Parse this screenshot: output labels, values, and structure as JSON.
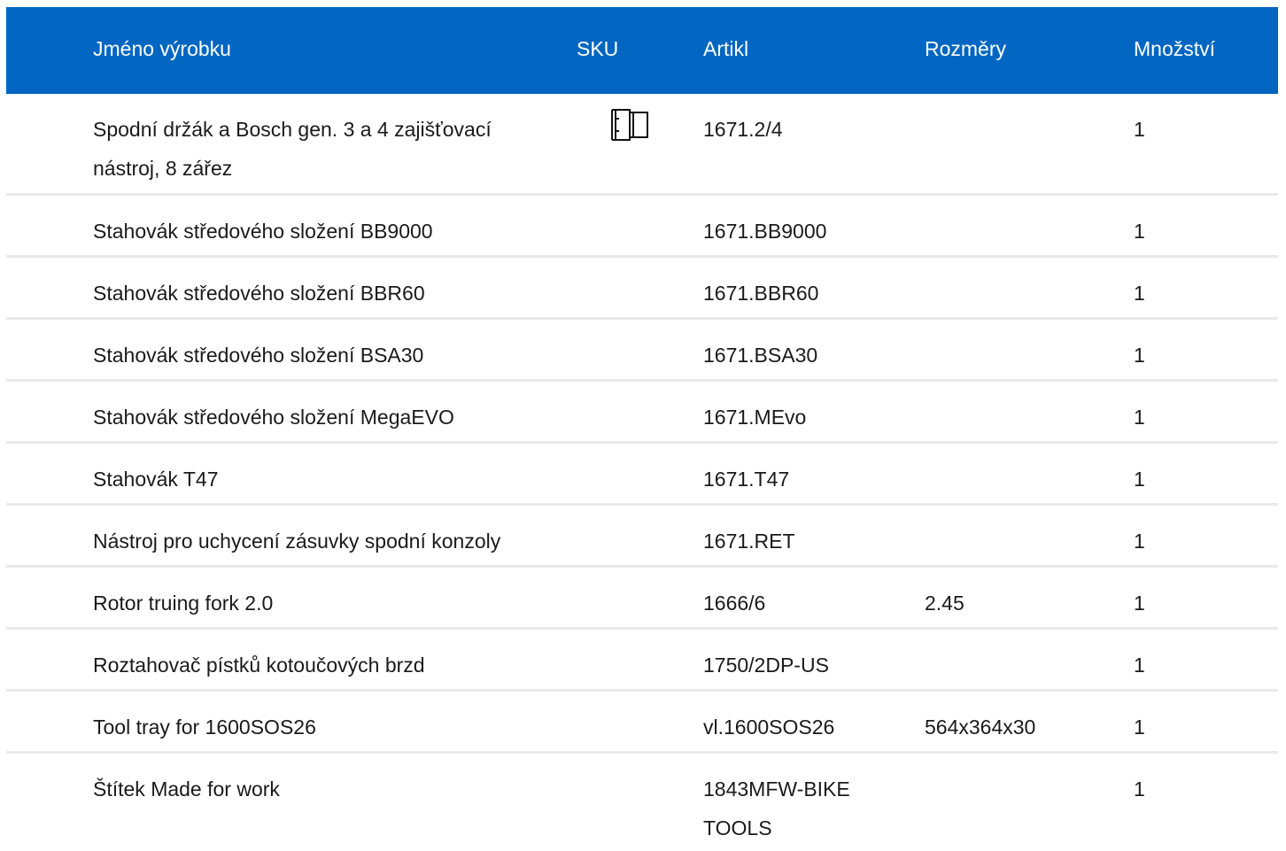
{
  "table": {
    "headers": {
      "name": "Jméno výrobku",
      "sku": "SKU",
      "article": "Artikl",
      "dimensions": "Rozměry",
      "quantity": "Množství"
    },
    "rows": [
      {
        "name": "Spodní držák a Bosch gen. 3 a 4 zajišťovací nástroj, 8 zářez",
        "sku_icon": "socket-tool-icon",
        "article": "1671.2/4",
        "dimensions": "",
        "quantity": "1"
      },
      {
        "name": "Stahovák středového složení BB9000",
        "article": "1671.BB9000",
        "dimensions": "",
        "quantity": "1"
      },
      {
        "name": "Stahovák středového složení BBR60",
        "article": "1671.BBR60",
        "dimensions": "",
        "quantity": "1"
      },
      {
        "name": "Stahovák středového složení BSA30",
        "article": "1671.BSA30",
        "dimensions": "",
        "quantity": "1"
      },
      {
        "name": "Stahovák středového složení MegaEVO",
        "article": "1671.MEvo",
        "dimensions": "",
        "quantity": "1"
      },
      {
        "name": "Stahovák T47",
        "article": "1671.T47",
        "dimensions": "",
        "quantity": "1"
      },
      {
        "name": "Nástroj pro uchycení zásuvky spodní konzoly",
        "article": "1671.RET",
        "dimensions": "",
        "quantity": "1"
      },
      {
        "name": "Rotor truing fork 2.0",
        "article": "1666/6",
        "dimensions": "2.45",
        "quantity": "1"
      },
      {
        "name": "Roztahovač pístků kotoučových brzd",
        "article": "1750/2DP-US",
        "dimensions": "",
        "quantity": "1"
      },
      {
        "name": "Tool tray for 1600SOS26",
        "article": "vl.1600SOS26",
        "dimensions": "564x364x30",
        "quantity": "1"
      },
      {
        "name": "Štítek Made for work",
        "article": "1843MFW-BIKE TOOLS",
        "dimensions": "",
        "quantity": "1"
      }
    ]
  },
  "colors": {
    "header_bg": "#0066c1",
    "header_text": "#ffffff",
    "row_divider": "#e9e9e9"
  }
}
